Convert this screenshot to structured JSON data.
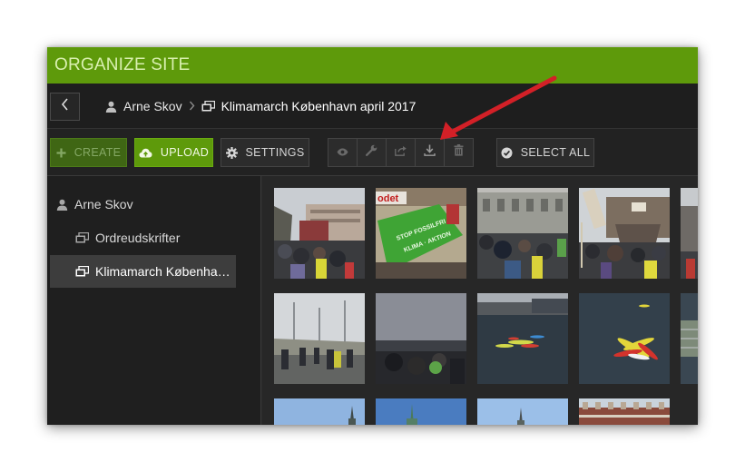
{
  "window": {
    "title": "ORGANIZE SITE"
  },
  "breadcrumb": {
    "items": [
      {
        "label": "Arne Skov",
        "icon": "user-icon"
      },
      {
        "label": "Klimamarch København april 2017",
        "icon": "album-icon"
      }
    ]
  },
  "toolbar": {
    "create_label": "CREATE",
    "upload_label": "UPLOAD",
    "settings_label": "SETTINGS",
    "select_all_label": "SELECT ALL",
    "icon_buttons": [
      "eye-icon",
      "wrench-icon",
      "share-icon",
      "download-icon",
      "trash-icon"
    ]
  },
  "sidebar": {
    "items": [
      {
        "label": "Arne Skov",
        "icon": "user-icon",
        "level": 0
      },
      {
        "label": "Ordreudskrifter",
        "icon": "album-icon",
        "level": 1
      },
      {
        "label": "Klimamarch Københav…",
        "icon": "album-icon",
        "level": 1,
        "selected": true
      }
    ]
  },
  "thumbnails": [
    "Crowd at rally in front of palace",
    "Green banner held by demonstrators",
    "Crowd in front of parliament building",
    "Rally with signs and stage",
    "Partial rally photo",
    "March along road with lampposts",
    "Marchers by waterfront at dusk",
    "Kayaks on canal",
    "Kayaks grouped on water",
    "Partial canal photo",
    "Spire against blue sky",
    "Green tower spire",
    "Spire against blue sky",
    "Brick building facade"
  ],
  "colors": {
    "accent": "#5e9a0b",
    "title_bar": "#5e9a0b",
    "background": "#2a2a2a",
    "annotation_arrow": "#d32027"
  }
}
